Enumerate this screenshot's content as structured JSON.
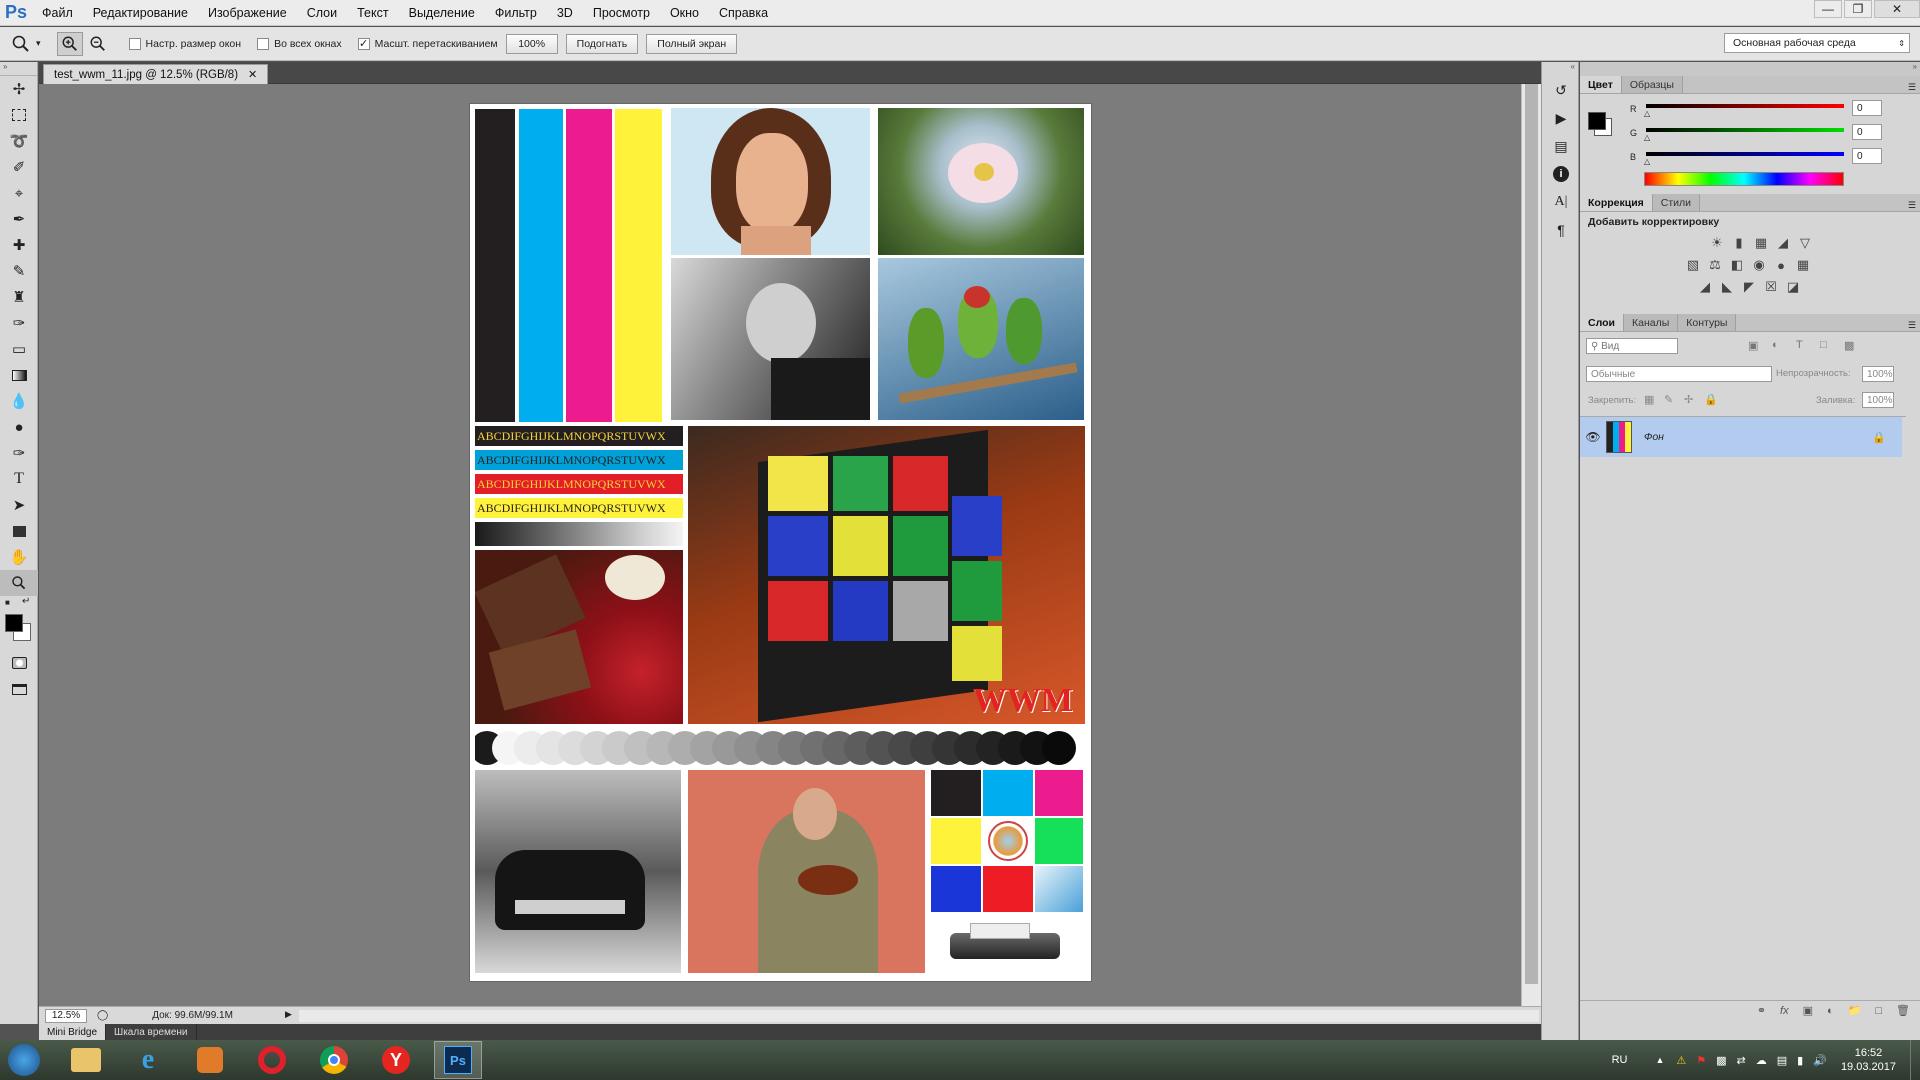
{
  "app": {
    "logo": "Ps"
  },
  "menu": [
    "Файл",
    "Редактирование",
    "Изображение",
    "Слои",
    "Текст",
    "Выделение",
    "Фильтр",
    "3D",
    "Просмотр",
    "Окно",
    "Справка"
  ],
  "options": {
    "resize_windows": "Настр. размер окон",
    "all_windows": "Во всех окнах",
    "scrubby_zoom": "Масшт. перетаскиванием",
    "zoom_value": "100%",
    "fit": "Подогнать",
    "fullscreen": "Полный экран",
    "workspace": "Основная рабочая среда",
    "scrubby_checked": true
  },
  "document": {
    "tab_title": "test_wwm_11.jpg @ 12.5% (RGB/8)",
    "zoom": "12.5%",
    "doc_size": "Док: 99.6M/99.1M",
    "alphabet": [
      "ABCDIFGHIJKLMNOPQRSTUVWX",
      "ABCDIFGHIJKLMNOPQRSTUVWX",
      "ABCDIFGHIJKLMNOPQRSTUVWX",
      "ABCDIFGHIJKLMNOPQRSTUVWX"
    ],
    "watermark": "WWM"
  },
  "bottom_tabs": [
    "Mini Bridge",
    "Шкала времени"
  ],
  "color_panel": {
    "tabs": [
      "Цвет",
      "Образцы"
    ],
    "channels": [
      {
        "label": "R",
        "value": "0"
      },
      {
        "label": "G",
        "value": "0"
      },
      {
        "label": "B",
        "value": "0"
      }
    ]
  },
  "adjust_panel": {
    "tabs": [
      "Коррекция",
      "Стили"
    ],
    "heading": "Добавить корректировку"
  },
  "layers_panel": {
    "tabs": [
      "Слои",
      "Каналы",
      "Контуры"
    ],
    "filter": "Вид",
    "blend_mode": "Обычные",
    "opacity_label": "Непрозрачность:",
    "opacity": "100%",
    "lock_label": "Закрепить:",
    "fill_label": "Заливка:",
    "fill": "100%",
    "layers": [
      {
        "name": "Фон",
        "visible": true,
        "locked": true
      }
    ]
  },
  "taskbar": {
    "lang": "RU",
    "time": "16:52",
    "date": "19.03.2017"
  }
}
